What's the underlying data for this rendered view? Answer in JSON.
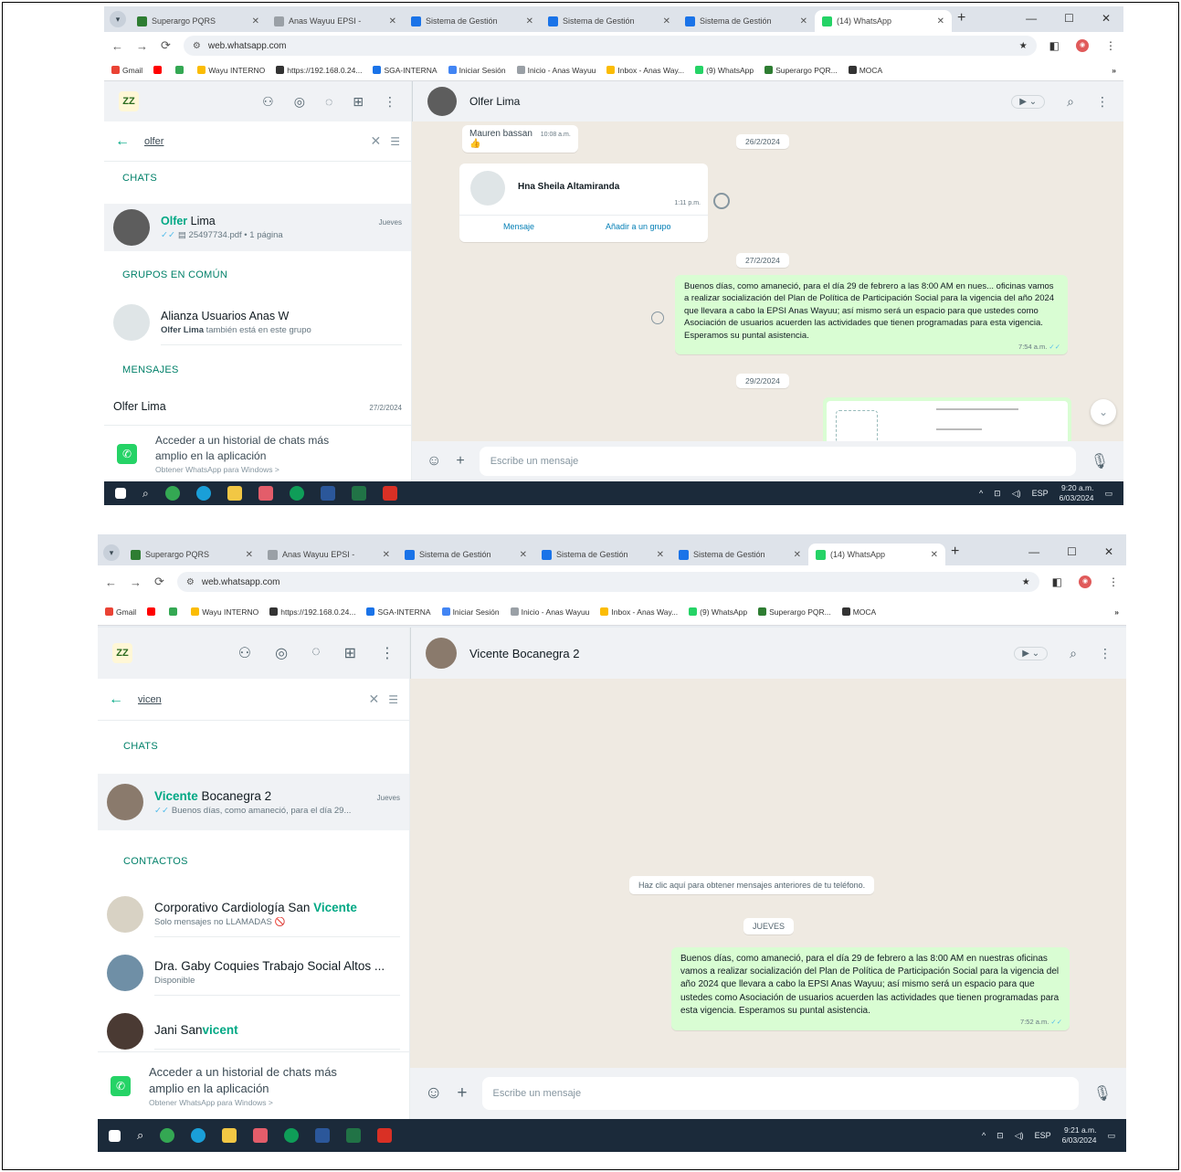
{
  "browser": {
    "tabs_1": [
      {
        "label": "Superargo PQRS",
        "color": "#2e7d32"
      },
      {
        "label": "Anas Wayuu EPSI - ",
        "color": "#9aa0a6"
      },
      {
        "label": "Sistema de Gestión",
        "color": "#1a73e8"
      },
      {
        "label": "Sistema de Gestión",
        "color": "#1a73e8"
      },
      {
        "label": "Sistema de Gestión",
        "color": "#1a73e8"
      },
      {
        "label": "(14) WhatsApp",
        "color": "#25d366"
      }
    ],
    "tabs_2": [
      {
        "label": "Superargo PQRS",
        "color": "#2e7d32"
      },
      {
        "label": "Anas Wayuu EPSI - ",
        "color": "#9aa0a6"
      },
      {
        "label": "Sistema de Gestión",
        "color": "#1a73e8"
      },
      {
        "label": "Sistema de Gestión",
        "color": "#1a73e8"
      },
      {
        "label": "Sistema de Gestión",
        "color": "#1a73e8"
      },
      {
        "label": "(14) WhatsApp",
        "color": "#25d366"
      }
    ],
    "url": "web.whatsapp.com",
    "bookmarks": [
      {
        "label": "Gmail",
        "color": "#ea4335"
      },
      {
        "label": "",
        "color": "#ff0000"
      },
      {
        "label": "",
        "color": "#34a853"
      },
      {
        "label": "Wayu INTERNO",
        "color": "#fbbc04"
      },
      {
        "label": "https://192.168.0.24...",
        "color": "#333333"
      },
      {
        "label": "SGA-INTERNA",
        "color": "#1a73e8"
      },
      {
        "label": "Iniciar Sesión",
        "color": "#4285f4"
      },
      {
        "label": "Inicio - Anas Wayuu",
        "color": "#9aa0a6"
      },
      {
        "label": "Inbox - Anas Way...",
        "color": "#fbbc04"
      },
      {
        "label": "(9) WhatsApp",
        "color": "#25d366"
      },
      {
        "label": "Superargo PQR...",
        "color": "#2e7d32"
      },
      {
        "label": "MOCA",
        "color": "#333333"
      }
    ],
    "bookmarks_more": "»"
  },
  "shot1": {
    "logo_text": "ZZ",
    "search_query": "olfer",
    "chats_label": "CHATS",
    "chat": {
      "name_match": "Olfer",
      "name_rest": " Lima",
      "time": "Jueves",
      "preview": "25497734.pdf • 1 página"
    },
    "groups_label": "GRUPOS EN COMÚN",
    "group": {
      "name": "Alianza Usuarios Anas W",
      "member_bold": "Olfer Lima",
      "member_rest": " también está en este grupo"
    },
    "messages_label": "MENSAJES",
    "message_row": {
      "name": "Olfer Lima",
      "date": "27/2/2024"
    },
    "banner": {
      "line1": "Acceder a un historial de chats más",
      "line2": "amplio en la aplicación",
      "link": "Obtener WhatsApp para Windows >"
    },
    "conv_title": "Olfer Lima",
    "prev_msg": {
      "text": "Mauren bassan",
      "time": "10:08 a.m."
    },
    "date1": "26/2/2024",
    "contact_card": {
      "name": "Hna Sheila Altamiranda",
      "time": "1:11 p.m.",
      "btn_message": "Mensaje",
      "btn_add": "Añadir a un grupo"
    },
    "date2": "27/2/2024",
    "bubble_text": "Buenos días, como amaneció, para el día 29 de febrero a las 8:00 AM en nues... oficinas vamos a realizar socialización del Plan de Política de Participación Social para la vigencia del año 2024 que llevara a cabo la EPSI Anas Wayuu; así mismo será un espacio para que ustedes como Asociación de usuarios acuerden las actividades que tienen programadas para esta vigencia. Esperamos su puntal asistencia.",
    "bubble_time": "7:54 a.m.",
    "date3": "29/2/2024",
    "composer_placeholder": "Escribe un mensaje",
    "clock_time": "9:20 a.m.",
    "clock_date": "6/03/2024",
    "lang": "ESP"
  },
  "shot2": {
    "logo_text": "ZZ",
    "search_query": "vicen",
    "chats_label": "CHATS",
    "chat": {
      "name_match": "Vicente",
      "name_rest": " Bocanegra 2",
      "time": "Jueves",
      "preview": "Buenos días, como amaneció, para el día 29..."
    },
    "contacts_label": "CONTACTOS",
    "contacts": [
      {
        "pre": "Corporativo Cardiología San ",
        "match": "Vicente",
        "post": "",
        "sub": "Solo mensajes no LLAMADAS 🚫"
      },
      {
        "pre": "Dra. Gaby Coquies Trabajo Social Altos ...",
        "match": "",
        "post": "",
        "sub": "Disponible"
      },
      {
        "pre": "Jani San",
        "match": "vicent",
        "post": "",
        "sub": ""
      }
    ],
    "banner": {
      "line1": "Acceder a un historial de chats más",
      "line2": "amplio en la aplicación",
      "link": "Obtener WhatsApp para Windows >"
    },
    "conv_title": "Vicente Bocanegra 2",
    "notice": "Haz clic aquí para obtener mensajes anteriores de tu teléfono.",
    "date1": "JUEVES",
    "bubble_text": "Buenos días, como amaneció, para el día 29 de febrero a las 8:00 AM en nuestras oficinas vamos a realizar socialización del Plan de Política de Participación Social para la vigencia del año 2024 que llevara a cabo la EPSI Anas Wayuu; así mismo será un espacio para que ustedes como Asociación de usuarios acuerden las actividades que tienen programadas para esta vigencia. Esperamos su puntal asistencia.",
    "bubble_time": "7:52 a.m.",
    "composer_placeholder": "Escribe un mensaje",
    "clock_time": "9:21 a.m.",
    "clock_date": "6/03/2024",
    "lang": "ESP"
  },
  "colors": {
    "accent": "#00a884",
    "bubble_out": "#d9fdd3",
    "chat_bg": "#efeae2",
    "taskbar": "#1b2a3a"
  }
}
